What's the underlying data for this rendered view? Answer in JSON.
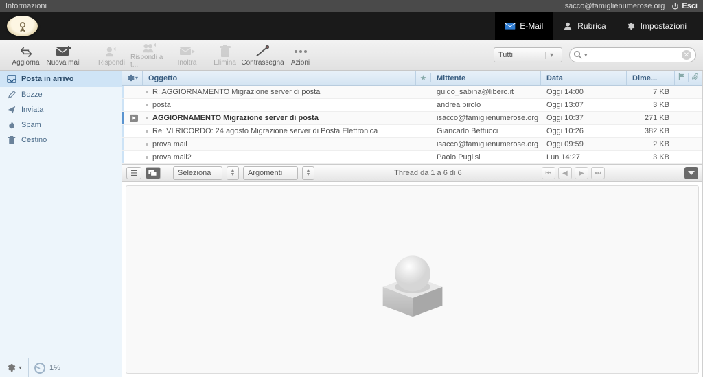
{
  "infobar": {
    "title": "Informazioni",
    "user_email": "isacco@famiglienumerose.org",
    "logout_label": "Esci"
  },
  "nav": {
    "email": "E-Mail",
    "rubrica": "Rubrica",
    "impostazioni": "Impostazioni"
  },
  "toolbar": {
    "aggiorna": "Aggiorna",
    "nuova_mail": "Nuova mail",
    "rispondi": "Rispondi",
    "rispondi_tutti": "Rispondi a t...",
    "inoltra": "Inoltra",
    "elimina": "Elimina",
    "contrassegna": "Contrassegna",
    "azioni": "Azioni",
    "filter_value": "Tutti"
  },
  "folders": {
    "inbox": "Posta in arrivo",
    "drafts": "Bozze",
    "sent": "Inviata",
    "spam": "Spam",
    "trash": "Cestino"
  },
  "quota": {
    "label": "1%"
  },
  "columns": {
    "oggetto": "Oggetto",
    "mittente": "Mittente",
    "data": "Data",
    "dime": "Dime..."
  },
  "messages": [
    {
      "subject": "R: AGGIORNAMENTO Migrazione server di posta",
      "from": "guido_sabina@libero.it",
      "date": "Oggi 14:00",
      "size": "7 KB",
      "unread": false,
      "forwarded": false
    },
    {
      "subject": "posta",
      "from": "andrea pirolo",
      "date": "Oggi 13:07",
      "size": "3 KB",
      "unread": false,
      "forwarded": false
    },
    {
      "subject": "AGGIORNAMENTO Migrazione server di posta",
      "from": "isacco@famiglienumerose.org",
      "date": "Oggi 10:37",
      "size": "271 KB",
      "unread": true,
      "forwarded": true
    },
    {
      "subject": "Re: VI RICORDO: 24 agosto Migrazione server di Posta Elettronica",
      "from": "Giancarlo Bettucci",
      "date": "Oggi 10:26",
      "size": "382 KB",
      "unread": false,
      "forwarded": false
    },
    {
      "subject": "prova mail",
      "from": "isacco@famiglienumerose.org",
      "date": "Oggi 09:59",
      "size": "2 KB",
      "unread": false,
      "forwarded": false
    },
    {
      "subject": "prova mail2",
      "from": "Paolo Puglisi",
      "date": "Lun 14:27",
      "size": "3 KB",
      "unread": false,
      "forwarded": false
    }
  ],
  "listbar": {
    "seleziona": "Seleziona",
    "argomenti": "Argomenti",
    "thread_info": "Thread da 1 a 6 di 6"
  }
}
